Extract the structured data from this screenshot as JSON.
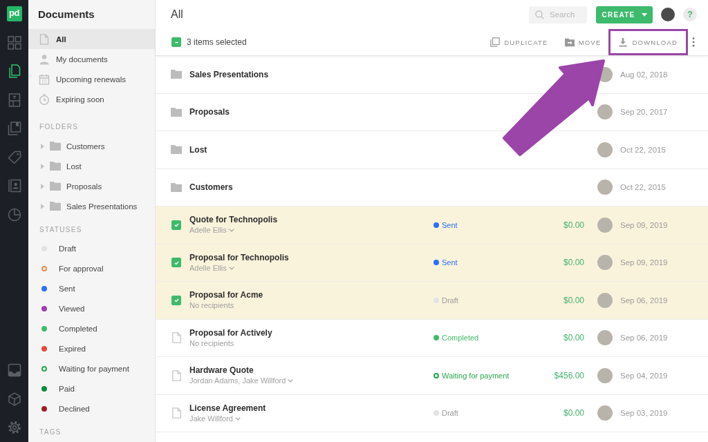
{
  "nav_rail": {
    "logo": "pd",
    "items": [
      {
        "selected": false
      },
      {
        "selected": true
      },
      {
        "selected": false
      },
      {
        "selected": false
      },
      {
        "selected": false
      },
      {
        "selected": false
      },
      {
        "selected": false
      }
    ],
    "bottom_items": [
      {
        "selected": false
      },
      {
        "selected": false
      },
      {
        "selected": false
      }
    ]
  },
  "sidebar": {
    "title": "Documents",
    "views": [
      {
        "label": "All",
        "selected": true
      },
      {
        "label": "My documents",
        "selected": false
      },
      {
        "label": "Upcoming renewals",
        "selected": false
      },
      {
        "label": "Expiring soon",
        "selected": false
      }
    ],
    "folders_heading": "FOLDERS",
    "folders": [
      {
        "name": "Customers",
        "expanded": false
      },
      {
        "name": "Lost",
        "expanded": false
      },
      {
        "name": "Proposals",
        "expanded": false
      },
      {
        "name": "Sales Presentations",
        "expanded": false
      }
    ],
    "statuses_heading": "STATUSES",
    "statuses": [
      {
        "label": "Draft",
        "kind": "dot",
        "color": "#e2e2e2"
      },
      {
        "label": "For approval",
        "kind": "ring",
        "color": "#f28c48"
      },
      {
        "label": "Sent",
        "kind": "dot",
        "color": "#2e6ff2"
      },
      {
        "label": "Viewed",
        "kind": "dot",
        "color": "#9b3fb0"
      },
      {
        "label": "Completed",
        "kind": "dot",
        "color": "#3fbb6b"
      },
      {
        "label": "Expired",
        "kind": "dot",
        "color": "#e8483f"
      },
      {
        "label": "Waiting for payment",
        "kind": "ring",
        "color": "#2aa64f"
      },
      {
        "label": "Paid",
        "kind": "dot",
        "color": "#0e8a3c"
      },
      {
        "label": "Declined",
        "kind": "dot",
        "color": "#9a2323"
      }
    ],
    "tags_heading": "TAGS"
  },
  "header": {
    "title": "All",
    "search": {
      "placeholder": "Search"
    },
    "create_button": "CREATE",
    "help_button": "?"
  },
  "selection_bar": {
    "select_all": {
      "checked": true,
      "indeterminate": true
    },
    "label": "3 items selected",
    "actions": [
      {
        "label": "DUPLICATE",
        "highlighted": false
      },
      {
        "label": "MOVE",
        "highlighted": false
      },
      {
        "label": "DOWNLOAD",
        "highlighted": true
      }
    ]
  },
  "annotation_arrow": true,
  "rows": [
    {
      "kind": "folder",
      "name": "Sales Presentations",
      "selected": false,
      "date": "Aug 02, 2018"
    },
    {
      "kind": "folder",
      "name": "Proposals",
      "selected": false,
      "date": "Sep 20, 2017"
    },
    {
      "kind": "folder",
      "name": "Lost",
      "selected": false,
      "date": "Oct 22, 2015"
    },
    {
      "kind": "folder",
      "name": "Customers",
      "selected": false,
      "date": "Oct 22, 2015"
    },
    {
      "kind": "document",
      "name": "Quote for Technopolis",
      "recipients": "Adelle Ellis",
      "recipients_menu": true,
      "selected": true,
      "status": {
        "label": "Sent",
        "kind": "dot",
        "color": "#2e6ff2"
      },
      "amount": "$0.00",
      "date": "Sep 09, 2019"
    },
    {
      "kind": "document",
      "name": "Proposal for Technopolis",
      "recipients": "Adelle Ellis",
      "recipients_menu": true,
      "selected": true,
      "status": {
        "label": "Sent",
        "kind": "dot",
        "color": "#2e6ff2"
      },
      "amount": "$0.00",
      "date": "Sep 09, 2019"
    },
    {
      "kind": "document",
      "name": "Proposal for Acme",
      "recipients": "No recipients",
      "recipients_menu": false,
      "selected": true,
      "status": {
        "label": "Draft",
        "kind": "dot",
        "color": "#e2e2e2"
      },
      "amount": "$0.00",
      "date": "Sep 06, 2019"
    },
    {
      "kind": "document",
      "name": "Proposal for Actively",
      "recipients": "No recipients",
      "recipients_menu": false,
      "selected": false,
      "status": {
        "label": "Completed",
        "kind": "dot",
        "color": "#3fbb6b"
      },
      "amount": "$0.00",
      "date": "Sep 06, 2019"
    },
    {
      "kind": "document",
      "name": "Hardware Quote",
      "recipients": "Jordan Adams, Jake Willford",
      "recipients_menu": true,
      "selected": false,
      "status": {
        "label": "Waiting for payment",
        "kind": "ring",
        "color": "#2aa64f"
      },
      "amount": "$456.00",
      "date": "Sep 04, 2019"
    },
    {
      "kind": "document",
      "name": "License Agreement",
      "recipients": "Jake Willford",
      "recipients_menu": true,
      "selected": false,
      "status": {
        "label": "Draft",
        "kind": "dot",
        "color": "#e2e2e2"
      },
      "amount": "$0.00",
      "date": "Sep 03, 2019"
    }
  ]
}
